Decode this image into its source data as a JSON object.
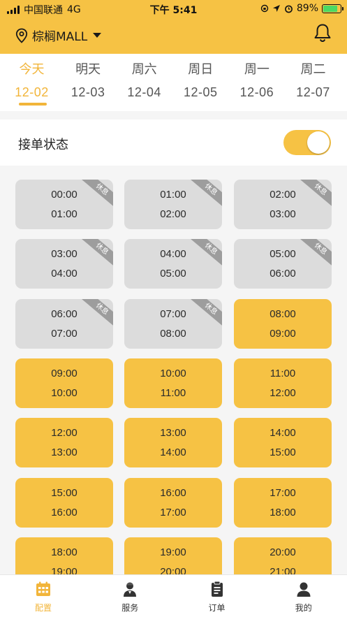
{
  "status_bar": {
    "carrier": "中国联通",
    "network": "4G",
    "time": "下午 5:41",
    "battery": "89%",
    "battery_level": 0.89
  },
  "header": {
    "location": "棕榈MALL",
    "bell_icon": "bell-icon",
    "location_icon": "location-pin-icon"
  },
  "dates": [
    {
      "day": "今天",
      "date": "12-02",
      "active": true
    },
    {
      "day": "明天",
      "date": "12-03",
      "active": false
    },
    {
      "day": "周六",
      "date": "12-04",
      "active": false
    },
    {
      "day": "周日",
      "date": "12-05",
      "active": false
    },
    {
      "day": "周一",
      "date": "12-06",
      "active": false
    },
    {
      "day": "周二",
      "date": "12-07",
      "active": false
    }
  ],
  "order_status": {
    "label": "接单状态",
    "enabled": true
  },
  "rest_label": "休息",
  "slots": [
    {
      "start": "00:00",
      "end": "01:00",
      "rest": true
    },
    {
      "start": "01:00",
      "end": "02:00",
      "rest": true
    },
    {
      "start": "02:00",
      "end": "03:00",
      "rest": true
    },
    {
      "start": "03:00",
      "end": "04:00",
      "rest": true
    },
    {
      "start": "04:00",
      "end": "05:00",
      "rest": true
    },
    {
      "start": "05:00",
      "end": "06:00",
      "rest": true
    },
    {
      "start": "06:00",
      "end": "07:00",
      "rest": true
    },
    {
      "start": "07:00",
      "end": "08:00",
      "rest": true
    },
    {
      "start": "08:00",
      "end": "09:00",
      "rest": false
    },
    {
      "start": "09:00",
      "end": "10:00",
      "rest": false
    },
    {
      "start": "10:00",
      "end": "11:00",
      "rest": false
    },
    {
      "start": "11:00",
      "end": "12:00",
      "rest": false
    },
    {
      "start": "12:00",
      "end": "13:00",
      "rest": false
    },
    {
      "start": "13:00",
      "end": "14:00",
      "rest": false
    },
    {
      "start": "14:00",
      "end": "15:00",
      "rest": false
    },
    {
      "start": "15:00",
      "end": "16:00",
      "rest": false
    },
    {
      "start": "16:00",
      "end": "17:00",
      "rest": false
    },
    {
      "start": "17:00",
      "end": "18:00",
      "rest": false
    },
    {
      "start": "18:00",
      "end": "19:00",
      "rest": false
    },
    {
      "start": "19:00",
      "end": "20:00",
      "rest": false
    },
    {
      "start": "20:00",
      "end": "21:00",
      "rest": false
    }
  ],
  "tabbar": [
    {
      "label": "配置",
      "icon": "calendar-grid-icon",
      "active": true
    },
    {
      "label": "服务",
      "icon": "service-person-icon",
      "active": false
    },
    {
      "label": "订单",
      "icon": "clipboard-icon",
      "active": false
    },
    {
      "label": "我的",
      "icon": "user-icon",
      "active": false
    }
  ],
  "colors": {
    "accent": "#f6c244",
    "accent_text": "#f2b53a",
    "rest_bg": "#dcdcdc",
    "ribbon": "#9d9d9d"
  }
}
